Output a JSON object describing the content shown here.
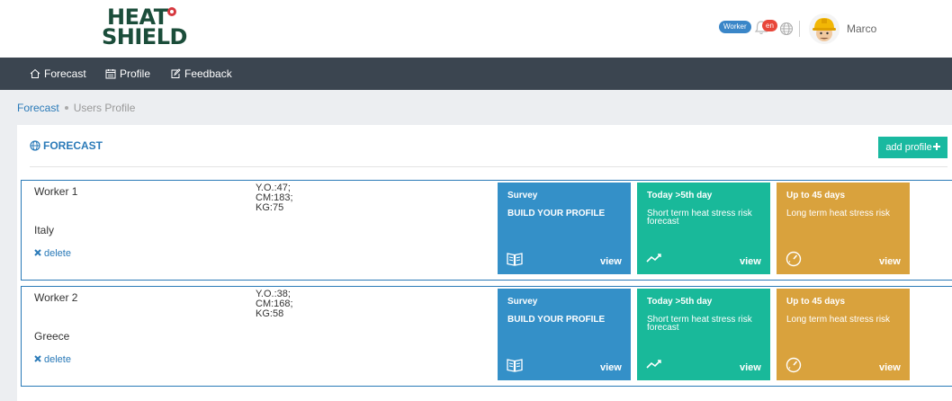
{
  "header": {
    "logo_line1": "HEAT",
    "logo_line2": "SHIELD",
    "role_badge": "Worker",
    "language": "en",
    "username": "Marco"
  },
  "nav": {
    "items": [
      {
        "label": "Forecast",
        "icon": "home-icon"
      },
      {
        "label": "Profile",
        "icon": "calendar-icon"
      },
      {
        "label": "Feedback",
        "icon": "edit-icon"
      }
    ]
  },
  "breadcrumb": {
    "link": "Forecast",
    "current": "Users Profile"
  },
  "panel": {
    "title": "FORECAST",
    "add_button": "add profile"
  },
  "workers": [
    {
      "name": "Worker 1",
      "age": "Y.O.:47;",
      "cm": "CM:183;",
      "kg": "KG:75",
      "country": "Italy",
      "delete": "delete",
      "cards": [
        {
          "title": "Survey",
          "subtitle": "BUILD YOUR PROFILE",
          "view": "view",
          "icon": "book-icon",
          "color": "#3490c8"
        },
        {
          "title": "Today >5th day",
          "subtitle": "Short term heat stress risk forecast",
          "view": "view",
          "icon": "trend-icon",
          "color": "#19b99a"
        },
        {
          "title": "Up to 45 days",
          "subtitle": "Long term heat stress risk",
          "view": "view",
          "icon": "gauge-icon",
          "color": "#d9a23d"
        }
      ]
    },
    {
      "name": "Worker 2",
      "age": "Y.O.:38;",
      "cm": "CM:168;",
      "kg": "KG:58",
      "country": "Greece",
      "delete": "delete",
      "cards": [
        {
          "title": "Survey",
          "subtitle": "BUILD YOUR PROFILE",
          "view": "view",
          "icon": "book-icon",
          "color": "#3490c8"
        },
        {
          "title": "Today >5th day",
          "subtitle": "Short term heat stress risk forecast",
          "view": "view",
          "icon": "trend-icon",
          "color": "#19b99a"
        },
        {
          "title": "Up to 45 days",
          "subtitle": "Long term heat stress risk",
          "view": "view",
          "icon": "gauge-icon",
          "color": "#d9a23d"
        }
      ]
    }
  ]
}
